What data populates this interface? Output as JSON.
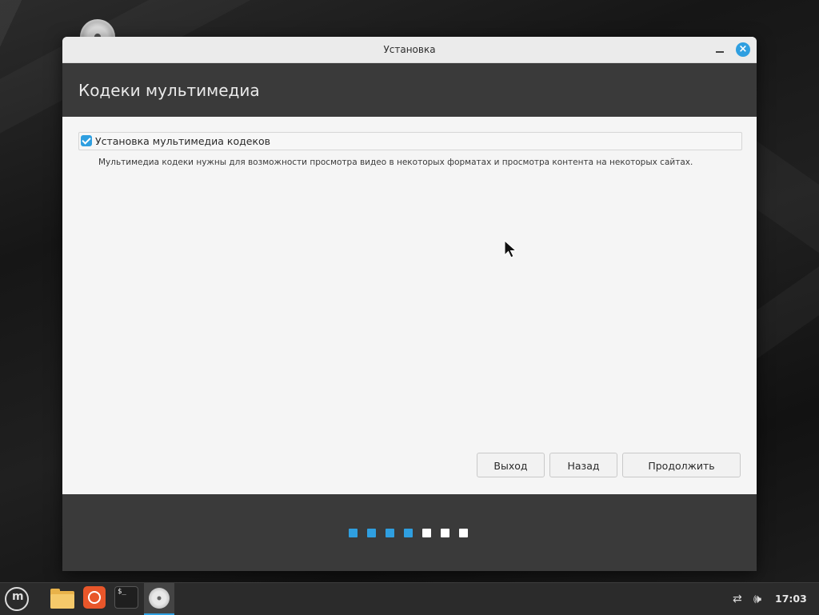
{
  "window": {
    "title": "Установка",
    "close_icon": "close-icon",
    "minimize_icon": "minimize-icon"
  },
  "page": {
    "heading": "Кодеки мультимедиа",
    "codec_checkbox": {
      "label": "Установка мультимедиа кодеков",
      "checked": true
    },
    "description": "Мультимедиа кодеки нужны для возможности просмотра видео в некоторых форматах и просмотра контента на некоторых сайтах."
  },
  "buttons": {
    "quit": "Выход",
    "back": "Назад",
    "continue": "Продолжить"
  },
  "progress": {
    "completed_steps": 4,
    "total_steps": 7
  },
  "taskbar": {
    "items": [
      "menu-icon",
      "files-icon",
      "firefox-icon",
      "terminal-icon",
      "installer-icon"
    ],
    "tray": [
      "network-disconnected-icon",
      "volume-icon"
    ],
    "clock": "17:03"
  },
  "colors": {
    "accent": "#2f9fe0",
    "header_bg": "#3a3a3a",
    "content_bg": "#f5f5f5",
    "folder": "#f5c96a",
    "firefox": "#e8562a"
  }
}
